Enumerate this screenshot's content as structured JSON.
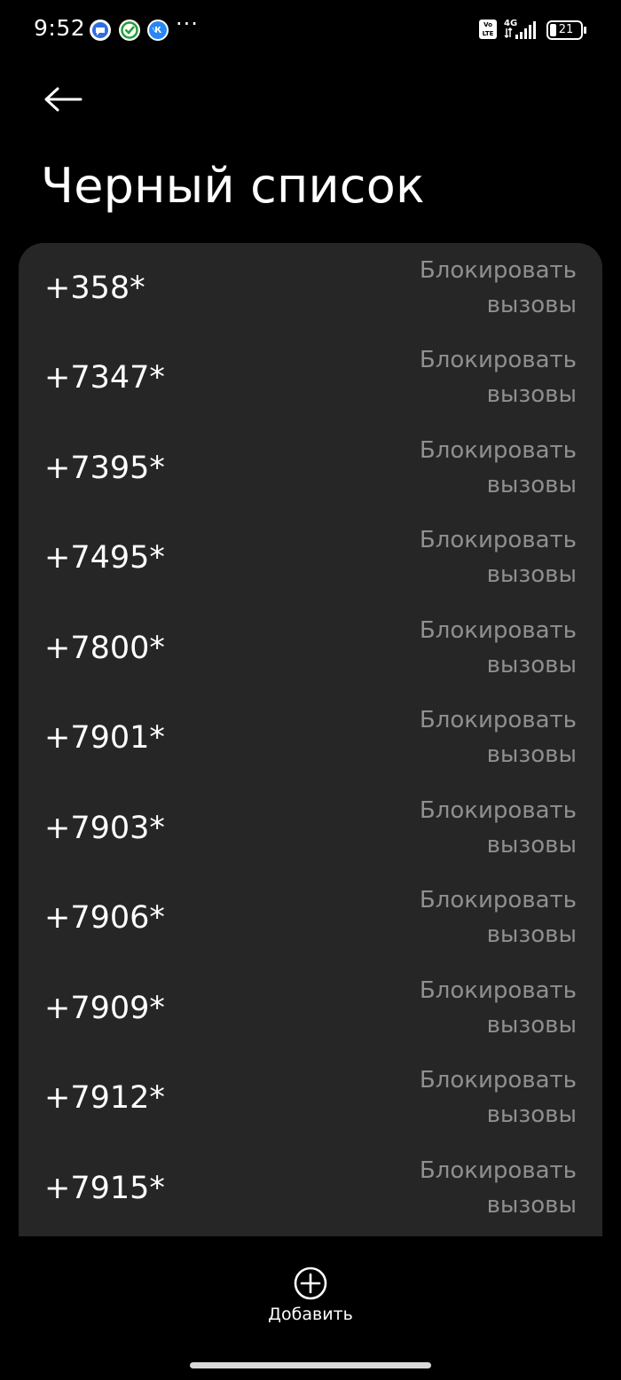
{
  "status_bar": {
    "time": "9:52",
    "volte_label": "Vo LTE",
    "network": "4G",
    "battery_level": "21"
  },
  "header": {
    "back_icon": "arrow-left-icon",
    "title": "Черный список"
  },
  "blacklist": {
    "items": [
      {
        "number": "+358*",
        "line1": "Блокировать",
        "line2": "вызовы"
      },
      {
        "number": "+7347*",
        "line1": "Блокировать",
        "line2": "вызовы"
      },
      {
        "number": "+7395*",
        "line1": "Блокировать",
        "line2": "вызовы"
      },
      {
        "number": "+7495*",
        "line1": "Блокировать",
        "line2": "вызовы"
      },
      {
        "number": "+7800*",
        "line1": "Блокировать",
        "line2": "вызовы"
      },
      {
        "number": "+7901*",
        "line1": "Блокировать",
        "line2": "вызовы"
      },
      {
        "number": "+7903*",
        "line1": "Блокировать",
        "line2": "вызовы"
      },
      {
        "number": "+7906*",
        "line1": "Блокировать",
        "line2": "вызовы"
      },
      {
        "number": "+7909*",
        "line1": "Блокировать",
        "line2": "вызовы"
      },
      {
        "number": "+7912*",
        "line1": "Блокировать",
        "line2": "вызовы"
      },
      {
        "number": "+7915*",
        "line1": "Блокировать",
        "line2": "вызовы"
      }
    ]
  },
  "bottom_bar": {
    "add_icon": "plus-circle-icon",
    "add_label": "Добавить"
  },
  "colors": {
    "background": "#000000",
    "card": "#262626",
    "primary_text": "#ffffff",
    "secondary_text": "#8f8f8f"
  }
}
